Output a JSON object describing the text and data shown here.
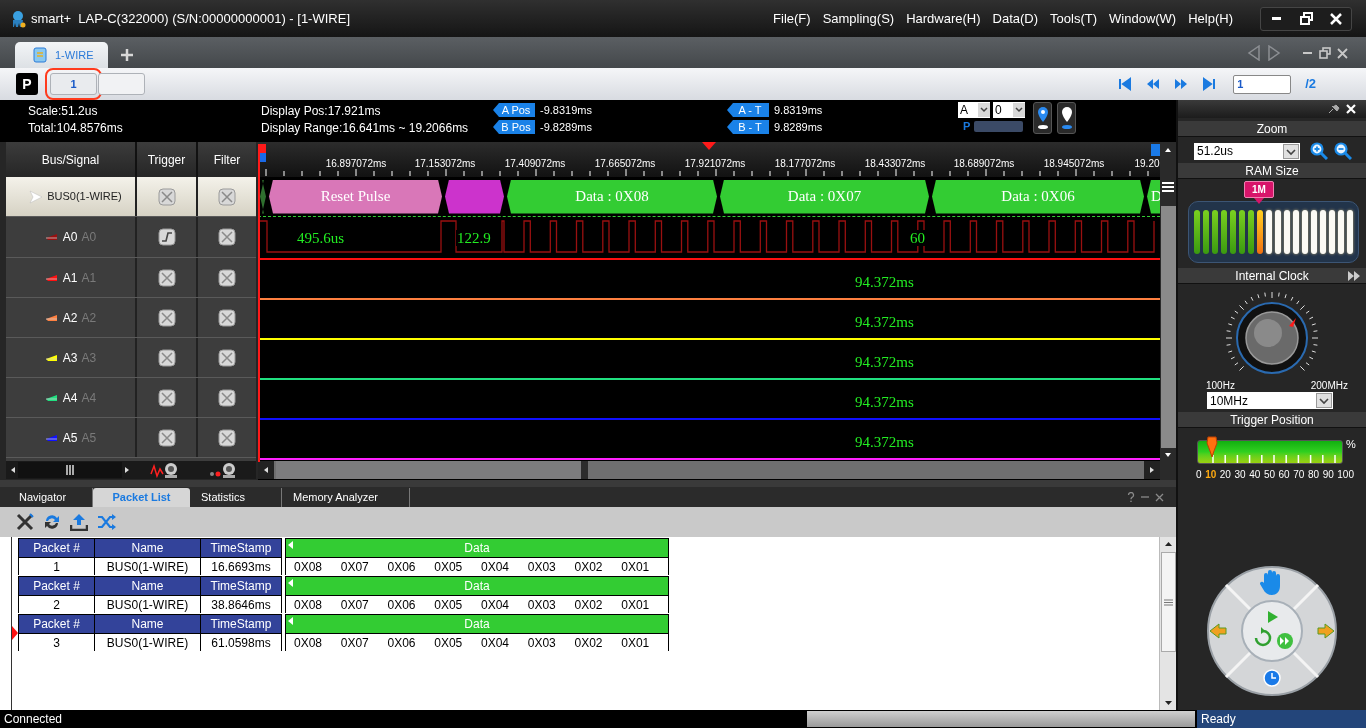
{
  "window": {
    "title": "smart+  LAP-C(322000) (S/N:00000000001) - [1-WIRE]",
    "menu": [
      "File(F)",
      "Sampling(S)",
      "Hardware(H)",
      "Data(D)",
      "Tools(T)",
      "Window(W)",
      "Help(H)"
    ]
  },
  "document_tabs": [
    {
      "label": "1-WIRE",
      "selected": true
    }
  ],
  "page_mode_label": "P",
  "page_buttons": [
    {
      "label": "1",
      "selected": true
    },
    {
      "selected": false
    }
  ],
  "page_input": "1",
  "page_count": "/2",
  "info": {
    "scale": "Scale:51.2us",
    "total": "Total:104.8576ms",
    "display_pos": "Display Pos:17.921ms",
    "display_range": "Display Range:16.641ms ~ 19.2066ms",
    "cursors": [
      {
        "badge": "A Pos",
        "value": "-9.8319ms"
      },
      {
        "badge": "B Pos",
        "value": "-9.8289ms"
      },
      {
        "badge": "A - T",
        "value": "9.8319ms"
      },
      {
        "badge": "B - T",
        "value": "9.8289ms"
      }
    ],
    "cursor_select": "A",
    "cursor_index": "0",
    "p_label": "P"
  },
  "signal_table": {
    "columns": [
      "Bus/Signal",
      "Trigger",
      "Filter"
    ],
    "rows": [
      {
        "kind": "bus",
        "name": "BUS0(1-WIRE)",
        "selected": true,
        "trigger_enabled": false
      },
      {
        "kind": "channel",
        "name": "A0",
        "alias": "A0",
        "color": "#9a1010",
        "trigger_enabled": true
      },
      {
        "kind": "channel",
        "name": "A1",
        "alias": "A1",
        "color": "#ff1010",
        "trigger_enabled": false
      },
      {
        "kind": "channel",
        "name": "A2",
        "alias": "A2",
        "color": "#ff8040",
        "trigger_enabled": false
      },
      {
        "kind": "channel",
        "name": "A3",
        "alias": "A3",
        "color": "#ffff00",
        "trigger_enabled": false
      },
      {
        "kind": "channel",
        "name": "A4",
        "alias": "A4",
        "color": "#20e080",
        "trigger_enabled": false
      },
      {
        "kind": "channel",
        "name": "A5",
        "alias": "A5",
        "color": "#1010ff",
        "trigger_enabled": false
      }
    ]
  },
  "ruler": {
    "labels": [
      "16.897072ms",
      "17.153072ms",
      "17.409072ms",
      "17.665072ms",
      "17.921072ms",
      "18.177072ms",
      "18.433072ms",
      "18.689072ms",
      "18.945072ms",
      "19.20"
    ]
  },
  "bus_segments": [
    {
      "color": "#2f6f2f"
    },
    {
      "label": "Reset Pulse",
      "color": "#d977b8"
    },
    {
      "color": "#cc33cc"
    },
    {
      "label": "Data : 0X08",
      "color": "#33cc33"
    },
    {
      "label": "Data : 0X07",
      "color": "#33cc33"
    },
    {
      "label": "Data : 0X06",
      "color": "#33cc33"
    },
    {
      "label": "D",
      "color": "#33cc33"
    }
  ],
  "a0_measurements": [
    "495.6us",
    "122.9",
    "60"
  ],
  "channel_measurements": [
    "94.372ms",
    "94.372ms",
    "94.372ms",
    "94.372ms",
    "94.372ms"
  ],
  "side_panel": {
    "zoom": {
      "title": "Zoom",
      "value": "51.2us"
    },
    "ram_size": {
      "title": "RAM Size",
      "label": "1M",
      "level": 0.4444
    },
    "clock": {
      "title": "Internal Clock",
      "min": "100Hz",
      "max": "200MHz",
      "value": "10MHz"
    },
    "trigger_position": {
      "title": "Trigger Position",
      "level": 0.1,
      "unit": "%",
      "ticks": [
        {
          "label": "0",
          "selected": false
        },
        {
          "label": "10",
          "selected": true
        },
        {
          "label": "20",
          "selected": false
        },
        {
          "label": "30",
          "selected": false
        },
        {
          "label": "40",
          "selected": false
        },
        {
          "label": "50",
          "selected": false
        },
        {
          "label": "60",
          "selected": false
        },
        {
          "label": "70",
          "selected": false
        },
        {
          "label": "80",
          "selected": false
        },
        {
          "label": "90",
          "selected": false
        },
        {
          "label": "100",
          "selected": false
        }
      ]
    }
  },
  "bottom_tabs": [
    {
      "label": "Navigator",
      "selected": false
    },
    {
      "label": "Packet List",
      "selected": true
    },
    {
      "label": "Statistics",
      "selected": false
    },
    {
      "label": "Memory Analyzer",
      "selected": false
    }
  ],
  "packets": [
    {
      "headers": [
        "Packet #",
        "Name",
        "TimeStamp",
        "Data"
      ],
      "number": "1",
      "name": "BUS0(1-WIRE)",
      "timestamp": "16.6693ms",
      "data": [
        "0X08",
        "0X07",
        "0X06",
        "0X05",
        "0X04",
        "0X03",
        "0X02",
        "0X01"
      ],
      "selected": false
    },
    {
      "headers": [
        "Packet #",
        "Name",
        "TimeStamp",
        "Data"
      ],
      "number": "2",
      "name": "BUS0(1-WIRE)",
      "timestamp": "38.8646ms",
      "data": [
        "0X08",
        "0X07",
        "0X06",
        "0X05",
        "0X04",
        "0X03",
        "0X02",
        "0X01"
      ],
      "selected": false
    },
    {
      "headers": [
        "Packet #",
        "Name",
        "TimeStamp",
        "Data"
      ],
      "number": "3",
      "name": "BUS0(1-WIRE)",
      "timestamp": "61.0598ms",
      "data": [
        "0X08",
        "0X07",
        "0X06",
        "0X05",
        "0X04",
        "0X03",
        "0X02",
        "0X01"
      ],
      "selected": true
    }
  ],
  "status_bar": {
    "left": "Connected",
    "right": "Ready"
  }
}
